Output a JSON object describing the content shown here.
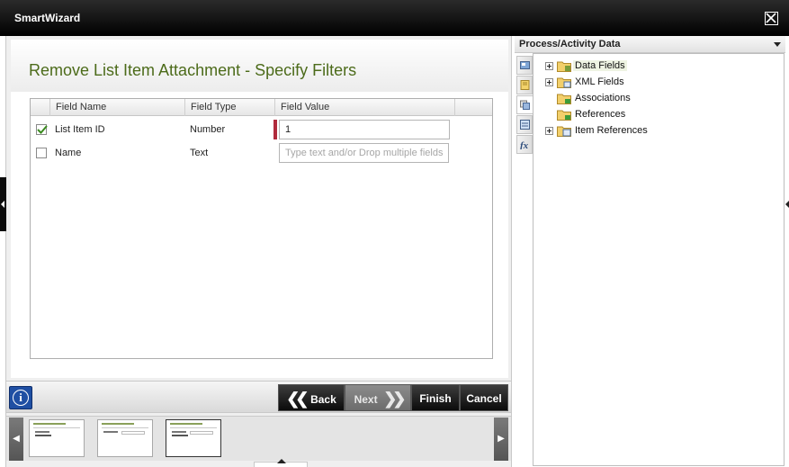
{
  "window": {
    "title": "SmartWizard"
  },
  "wizard": {
    "heading": "Remove List Item Attachment - Specify Filters",
    "columns": [
      "Field Name",
      "Field Type",
      "Field Value"
    ],
    "rows": [
      {
        "checked": true,
        "field_name": "List Item ID",
        "field_type": "Number",
        "value": "1",
        "placeholder": ""
      },
      {
        "checked": false,
        "field_name": "Name",
        "field_type": "Text",
        "value": "",
        "placeholder": "Type text and/or Drop multiple fields"
      }
    ],
    "buttons": {
      "back": "Back",
      "next": "Next",
      "finish": "Finish",
      "cancel": "Cancel"
    },
    "thumbnails_count": 3,
    "active_thumbnail": 3
  },
  "side_panel": {
    "title": "Process/Activity Data",
    "tree": [
      {
        "label": "Data Fields",
        "expandable": true,
        "icon": "folder-data-icon"
      },
      {
        "label": "XML Fields",
        "expandable": true,
        "icon": "folder-xml-icon"
      },
      {
        "label": "Associations",
        "expandable": false,
        "icon": "folder-associations-icon"
      },
      {
        "label": "References",
        "expandable": false,
        "icon": "folder-references-icon"
      },
      {
        "label": "Item References",
        "expandable": true,
        "icon": "folder-item-references-icon"
      }
    ],
    "vertical_tabs": [
      "image-tab-icon",
      "document-tab-icon",
      "data-tab-icon",
      "form-tab-icon",
      "function-tab-icon"
    ]
  },
  "colors": {
    "heading": "#4c6b1a",
    "required": "#b02a3c",
    "info": "#1f4fa3"
  }
}
